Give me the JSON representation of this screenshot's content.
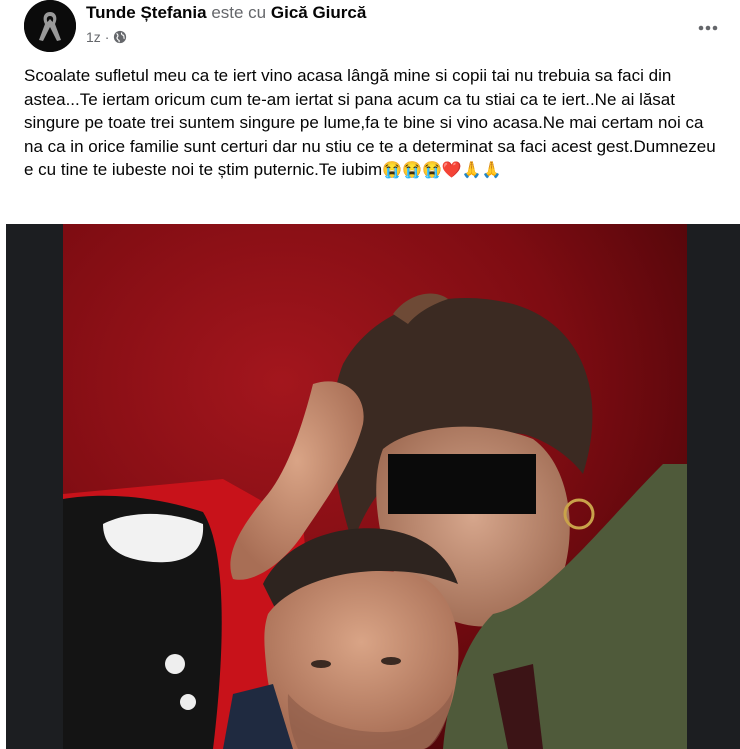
{
  "post": {
    "author": "Tunde Ștefania",
    "with_text": "este cu",
    "tagged": "Gică Giurcă",
    "time": "1z",
    "separator": "·",
    "audience_icon": "globe-icon",
    "more_icon": "more-horizontal-icon",
    "avatar_icon": "mourning-ribbon-icon",
    "text": "Scoalate sufletul meu ca te iert vino acasa lângă mine si copii tai nu trebuia sa faci din astea...Te iertam oricum cum te-am iertat si pana acum ca tu stiai ca te iert..Ne ai lăsat singure pe toate trei suntem singure pe lume,fa te bine si vino acasa.Ne mai certam noi ca na ca in orice familie sunt certuri dar nu stiu ce te a determinat sa faci acest gest.Dumnezeu e cu tine te iubeste noi te știm puternic.Te iubim",
    "emojis": "😭😭😭❤️🙏🙏"
  },
  "colors": {
    "photo_background": "#8e1016",
    "frame": "#1c1e21",
    "secondary_text": "#65676b"
  }
}
